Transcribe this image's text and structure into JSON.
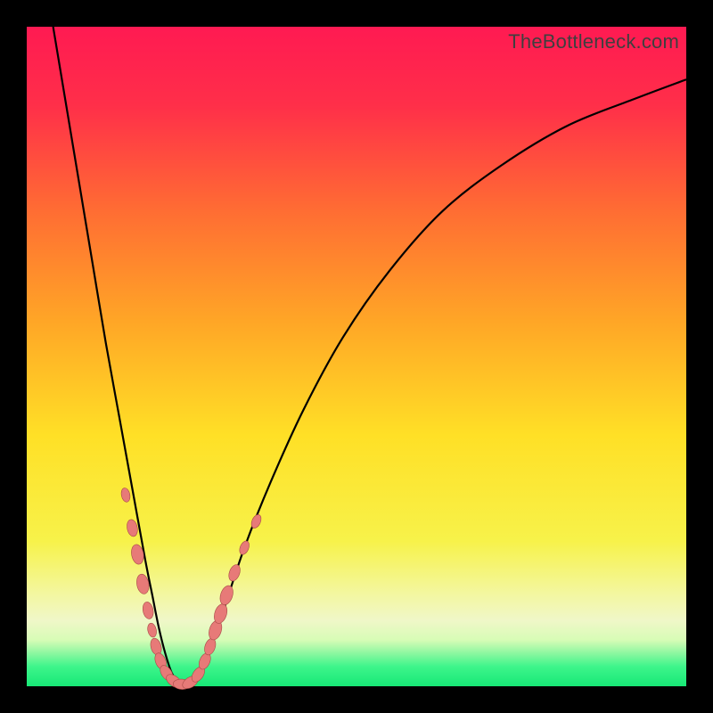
{
  "watermark": "TheBottleneck.com",
  "colors": {
    "frame": "#000000",
    "gradient_stops": [
      {
        "pct": 0,
        "color": "#ff1a52"
      },
      {
        "pct": 12,
        "color": "#ff2f49"
      },
      {
        "pct": 28,
        "color": "#ff6d33"
      },
      {
        "pct": 45,
        "color": "#ffa726"
      },
      {
        "pct": 62,
        "color": "#ffe026"
      },
      {
        "pct": 78,
        "color": "#f7f24a"
      },
      {
        "pct": 86,
        "color": "#f3f7a0"
      },
      {
        "pct": 90,
        "color": "#f0f7c8"
      },
      {
        "pct": 93,
        "color": "#d7fcb6"
      },
      {
        "pct": 95,
        "color": "#8cf7a0"
      },
      {
        "pct": 97,
        "color": "#3ef58b"
      },
      {
        "pct": 100,
        "color": "#17e876"
      }
    ],
    "curve": "#000000",
    "bead_fill": "#e77a78",
    "bead_stroke": "#a84a46"
  },
  "chart_data": {
    "type": "line",
    "title": "",
    "xlabel": "",
    "ylabel": "",
    "xlim": [
      0,
      100
    ],
    "ylim": [
      0,
      100
    ],
    "annotations": [
      "TheBottleneck.com"
    ],
    "grid": false,
    "legend": false,
    "series": [
      {
        "name": "v-curve",
        "x": [
          4,
          6,
          8,
          10,
          12,
          14,
          16,
          18,
          19,
          20,
          21,
          22,
          23,
          24,
          25,
          26,
          28,
          30,
          33,
          37,
          42,
          48,
          55,
          63,
          72,
          82,
          92,
          100
        ],
        "y": [
          100,
          88,
          76,
          64,
          52,
          41,
          30,
          19,
          14,
          9,
          5,
          2,
          0.5,
          0,
          0.5,
          2,
          6,
          12,
          21,
          31,
          42,
          53,
          63,
          72,
          79,
          85,
          89,
          92
        ]
      }
    ],
    "beads": {
      "name": "cluster-points",
      "points": [
        {
          "x": 15.0,
          "y": 29.0,
          "r": 5
        },
        {
          "x": 16.0,
          "y": 24.0,
          "r": 6
        },
        {
          "x": 16.8,
          "y": 20.0,
          "r": 7
        },
        {
          "x": 17.6,
          "y": 15.5,
          "r": 7
        },
        {
          "x": 18.4,
          "y": 11.5,
          "r": 6
        },
        {
          "x": 19.0,
          "y": 8.5,
          "r": 5
        },
        {
          "x": 19.6,
          "y": 6.0,
          "r": 6
        },
        {
          "x": 20.3,
          "y": 3.8,
          "r": 6
        },
        {
          "x": 21.2,
          "y": 2.0,
          "r": 6
        },
        {
          "x": 22.3,
          "y": 0.8,
          "r": 6
        },
        {
          "x": 23.5,
          "y": 0.3,
          "r": 6
        },
        {
          "x": 24.8,
          "y": 0.6,
          "r": 6
        },
        {
          "x": 26.0,
          "y": 1.8,
          "r": 6
        },
        {
          "x": 27.0,
          "y": 3.8,
          "r": 6
        },
        {
          "x": 27.8,
          "y": 6.0,
          "r": 6
        },
        {
          "x": 28.6,
          "y": 8.5,
          "r": 7
        },
        {
          "x": 29.4,
          "y": 11.0,
          "r": 7
        },
        {
          "x": 30.3,
          "y": 13.8,
          "r": 7
        },
        {
          "x": 31.5,
          "y": 17.2,
          "r": 6
        },
        {
          "x": 33.0,
          "y": 21.0,
          "r": 5
        },
        {
          "x": 34.8,
          "y": 25.0,
          "r": 5
        }
      ]
    }
  }
}
